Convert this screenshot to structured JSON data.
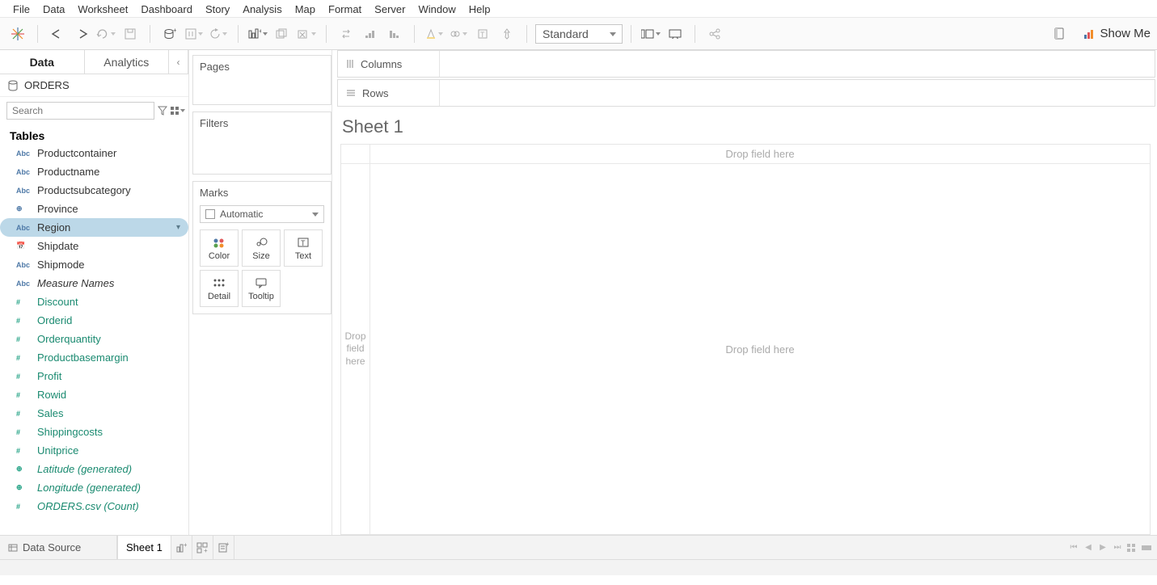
{
  "menu": [
    "File",
    "Data",
    "Worksheet",
    "Dashboard",
    "Story",
    "Analysis",
    "Map",
    "Format",
    "Server",
    "Window",
    "Help"
  ],
  "toolbar": {
    "fit_mode": "Standard",
    "show_me": "Show Me"
  },
  "data_pane": {
    "tab_data": "Data",
    "tab_analytics": "Analytics",
    "datasource": "ORDERS",
    "search_placeholder": "Search",
    "tables_header": "Tables",
    "fields": [
      {
        "icon": "Abc",
        "label": "Productcontainer",
        "kind": "dimension"
      },
      {
        "icon": "Abc",
        "label": "Productname",
        "kind": "dimension"
      },
      {
        "icon": "Abc",
        "label": "Productsubcategory",
        "kind": "dimension"
      },
      {
        "icon": "⊕",
        "label": "Province",
        "kind": "dimension"
      },
      {
        "icon": "Abc",
        "label": "Region",
        "kind": "dimension",
        "selected": true
      },
      {
        "icon": "📅",
        "label": "Shipdate",
        "kind": "dimension"
      },
      {
        "icon": "Abc",
        "label": "Shipmode",
        "kind": "dimension"
      },
      {
        "icon": "Abc",
        "label": "Measure Names",
        "kind": "dimension",
        "italic": true
      },
      {
        "icon": "#",
        "label": "Discount",
        "kind": "measure"
      },
      {
        "icon": "#",
        "label": "Orderid",
        "kind": "measure"
      },
      {
        "icon": "#",
        "label": "Orderquantity",
        "kind": "measure"
      },
      {
        "icon": "#",
        "label": "Productbasemargin",
        "kind": "measure"
      },
      {
        "icon": "#",
        "label": "Profit",
        "kind": "measure"
      },
      {
        "icon": "#",
        "label": "Rowid",
        "kind": "measure"
      },
      {
        "icon": "#",
        "label": "Sales",
        "kind": "measure"
      },
      {
        "icon": "#",
        "label": "Shippingcosts",
        "kind": "measure"
      },
      {
        "icon": "#",
        "label": "Unitprice",
        "kind": "measure"
      },
      {
        "icon": "⊕",
        "label": "Latitude (generated)",
        "kind": "measure",
        "italic": true
      },
      {
        "icon": "⊕",
        "label": "Longitude (generated)",
        "kind": "measure",
        "italic": true
      },
      {
        "icon": "#",
        "label": "ORDERS.csv (Count)",
        "kind": "measure",
        "italic": true
      }
    ]
  },
  "shelves": {
    "pages": "Pages",
    "filters": "Filters",
    "marks": "Marks",
    "mark_type": "Automatic",
    "marks_buttons": [
      "Color",
      "Size",
      "Text",
      "Detail",
      "Tooltip"
    ]
  },
  "ws": {
    "columns": "Columns",
    "rows": "Rows",
    "sheet_title": "Sheet 1",
    "drop_here": "Drop field here",
    "drop_here_vert": "Drop\nfield\nhere"
  },
  "bottom": {
    "data_source": "Data Source",
    "sheet": "Sheet 1"
  }
}
